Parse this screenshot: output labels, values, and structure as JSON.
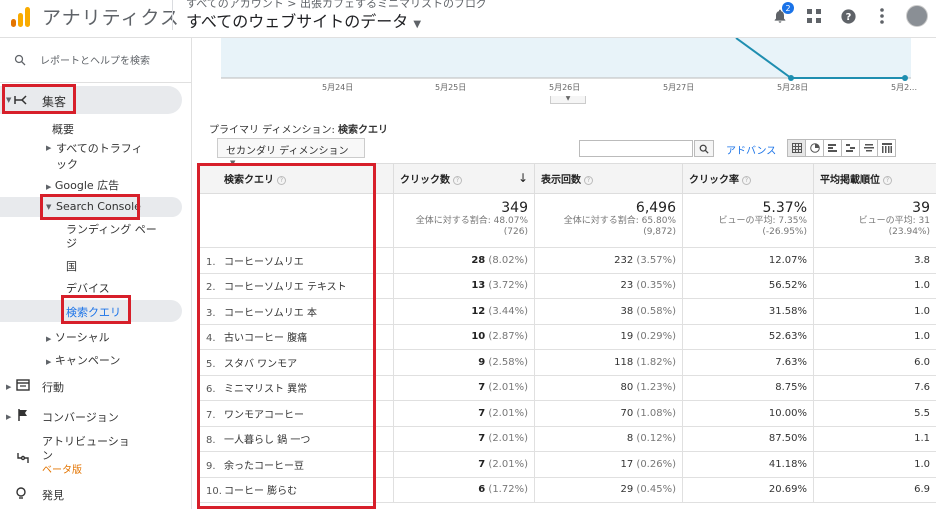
{
  "header": {
    "app_name": "アナリティクス",
    "breadcrumb": "すべてのアカウント > 出張カフェするミニマリストのブログ",
    "view_title": "すべてのウェブサイトのデータ",
    "notification_count": "2"
  },
  "sidebar": {
    "search_placeholder": "レポートとヘルプを検索",
    "acquisition": "集客",
    "overview": "概要",
    "all_traffic_line1": "すべてのトラフィ",
    "all_traffic_line2": "ック",
    "google_ads": "Google 広告",
    "search_console": "Search Console",
    "landing_pages_line1": "ランディング ペー",
    "landing_pages_line2": "ジ",
    "countries": "国",
    "devices": "デバイス",
    "queries": "検索クエリ",
    "social": "ソーシャル",
    "campaigns": "キャンペーン",
    "behavior": "行動",
    "conversions": "コンバージョン",
    "attribution_line1": "アトリビューショ",
    "attribution_line2": "ン",
    "beta": "ベータ版",
    "discover": "発見"
  },
  "chart_axis": {
    "dates": [
      "5月24日",
      "5月25日",
      "5月26日",
      "5月27日",
      "5月28日",
      "5月2…"
    ]
  },
  "report": {
    "primary_dimension_label": "プライマリ ディメンション:",
    "primary_dimension_value": "検索クエリ",
    "secondary_dimension": "セカンダリ ディメンション",
    "advanced": "アドバンス"
  },
  "table": {
    "headers": [
      "検索クエリ",
      "クリック数",
      "表示回数",
      "クリック率",
      "平均掲載順位"
    ],
    "sort_icon": "↓",
    "totals": {
      "clicks": "349",
      "clicks_sub1": "全体に対する割合: 48.07%",
      "clicks_sub2": "(726)",
      "impressions": "6,496",
      "impressions_sub1": "全体に対する割合: 65.80%",
      "impressions_sub2": "(9,872)",
      "ctr": "5.37%",
      "ctr_sub1": "ビューの平均: 7.35%",
      "ctr_sub2": "(-26.95%)",
      "position": "39",
      "position_sub1": "ビューの平均: 31",
      "position_sub2": "(23.94%)"
    },
    "rows": [
      {
        "rank": "1.",
        "query": "コーヒーソムリエ",
        "clicks": "28",
        "clicks_pct": "(8.02%)",
        "impressions": "232",
        "impressions_pct": "(3.57%)",
        "ctr": "12.07%",
        "position": "3.8"
      },
      {
        "rank": "2.",
        "query": "コーヒーソムリエ テキスト",
        "clicks": "13",
        "clicks_pct": "(3.72%)",
        "impressions": "23",
        "impressions_pct": "(0.35%)",
        "ctr": "56.52%",
        "position": "1.0"
      },
      {
        "rank": "3.",
        "query": "コーヒーソムリエ 本",
        "clicks": "12",
        "clicks_pct": "(3.44%)",
        "impressions": "38",
        "impressions_pct": "(0.58%)",
        "ctr": "31.58%",
        "position": "1.0"
      },
      {
        "rank": "4.",
        "query": "古いコーヒー 腹痛",
        "clicks": "10",
        "clicks_pct": "(2.87%)",
        "impressions": "19",
        "impressions_pct": "(0.29%)",
        "ctr": "52.63%",
        "position": "1.0"
      },
      {
        "rank": "5.",
        "query": "スタバ ワンモア",
        "clicks": "9",
        "clicks_pct": "(2.58%)",
        "impressions": "118",
        "impressions_pct": "(1.82%)",
        "ctr": "7.63%",
        "position": "6.0"
      },
      {
        "rank": "6.",
        "query": "ミニマリスト 異常",
        "clicks": "7",
        "clicks_pct": "(2.01%)",
        "impressions": "80",
        "impressions_pct": "(1.23%)",
        "ctr": "8.75%",
        "position": "7.6"
      },
      {
        "rank": "7.",
        "query": "ワンモアコーヒー",
        "clicks": "7",
        "clicks_pct": "(2.01%)",
        "impressions": "70",
        "impressions_pct": "(1.08%)",
        "ctr": "10.00%",
        "position": "5.5"
      },
      {
        "rank": "8.",
        "query": "一人暮らし 鍋 一つ",
        "clicks": "7",
        "clicks_pct": "(2.01%)",
        "impressions": "8",
        "impressions_pct": "(0.12%)",
        "ctr": "87.50%",
        "position": "1.1"
      },
      {
        "rank": "9.",
        "query": "余ったコーヒー豆",
        "clicks": "7",
        "clicks_pct": "(2.01%)",
        "impressions": "17",
        "impressions_pct": "(0.26%)",
        "ctr": "41.18%",
        "position": "1.0"
      },
      {
        "rank": "10.",
        "query": "コーヒー 膨らむ",
        "clicks": "6",
        "clicks_pct": "(1.72%)",
        "impressions": "29",
        "impressions_pct": "(0.45%)",
        "ctr": "20.69%",
        "position": "6.9"
      }
    ]
  },
  "colors": {
    "accent": "#1a73e8",
    "highlight_box": "#d71f2a",
    "chart_line": "#1f8eb0",
    "chart_fill": "#e8f3f9"
  }
}
